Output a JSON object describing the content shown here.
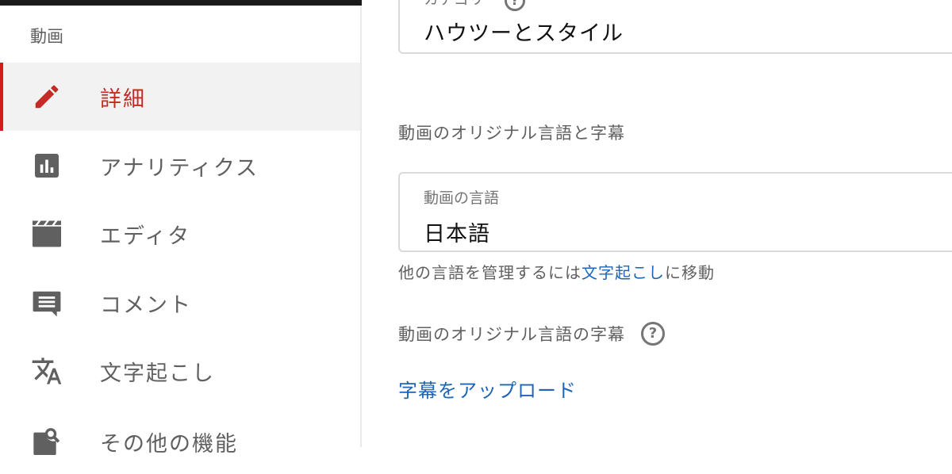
{
  "sidebar": {
    "section_label": "動画",
    "items": [
      {
        "label": "詳細",
        "icon": "pencil-icon",
        "active": true
      },
      {
        "label": "アナリティクス",
        "icon": "bar-chart-icon",
        "active": false
      },
      {
        "label": "エディタ",
        "icon": "clapperboard-icon",
        "active": false
      },
      {
        "label": "コメント",
        "icon": "comment-icon",
        "active": false
      },
      {
        "label": "文字起こし",
        "icon": "translate-icon",
        "active": false
      },
      {
        "label": "その他の機能",
        "icon": "feature-search-icon",
        "active": false
      }
    ]
  },
  "main": {
    "category": {
      "caption": "カテゴリ",
      "value": "ハウツーとスタイル"
    },
    "language_section_title": "動画のオリジナル言語と字幕",
    "video_language": {
      "caption": "動画の言語",
      "value": "日本語"
    },
    "hint": {
      "prefix": "他の言語を管理するには",
      "link": "文字起こし",
      "suffix": "に移動"
    },
    "subtitle_section_title": "動画のオリジナル言語の字幕",
    "upload_link": "字幕をアップロード"
  },
  "colors": {
    "accent": "#c62a24",
    "link": "#1f64b5",
    "icon": "#606060"
  }
}
